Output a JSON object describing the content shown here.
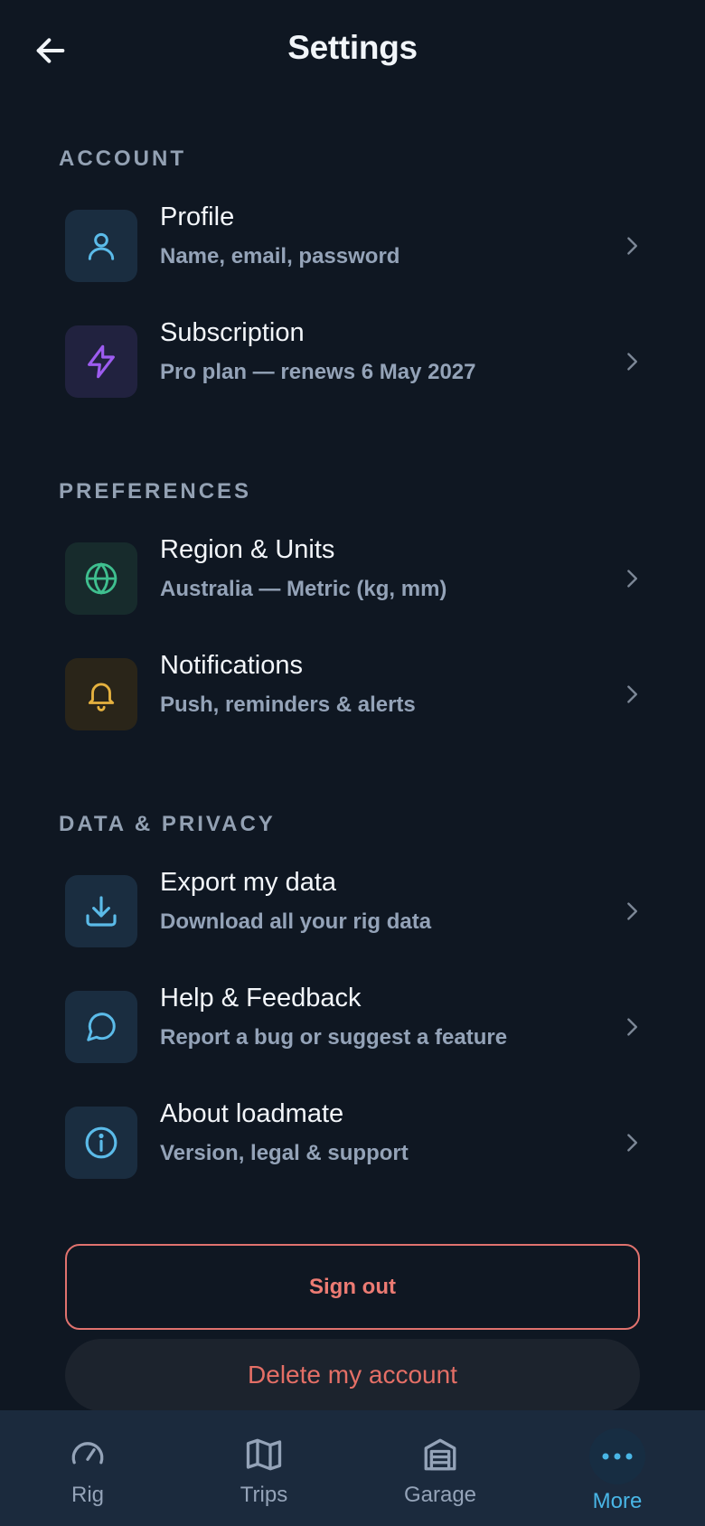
{
  "header": {
    "title": "Settings"
  },
  "sections": {
    "account": {
      "title": "ACCOUNT",
      "items": [
        {
          "title": "Profile",
          "subtitle": "Name, email, password",
          "icon": "user-icon"
        },
        {
          "title": "Subscription",
          "subtitle": "Pro plan — renews 6 May 2027",
          "icon": "lightning-icon"
        }
      ]
    },
    "preferences": {
      "title": "PREFERENCES",
      "items": [
        {
          "title": "Region & Units",
          "subtitle": "Australia — Metric (kg, mm)",
          "icon": "globe-icon"
        },
        {
          "title": "Notifications",
          "subtitle": "Push, reminders & alerts",
          "icon": "bell-icon"
        }
      ]
    },
    "privacy": {
      "title": "DATA & PRIVACY",
      "items": [
        {
          "title": "Export my data",
          "subtitle": "Download all your rig data",
          "icon": "download-icon"
        },
        {
          "title": "Help & Feedback",
          "subtitle": "Report a bug or suggest a feature",
          "icon": "chat-bubble-icon"
        },
        {
          "title": "About loadmate",
          "subtitle": "Version, legal & support",
          "icon": "info-icon"
        }
      ]
    }
  },
  "actions": {
    "sign_out": "Sign out",
    "delete_account": "Delete my account"
  },
  "nav": {
    "items": [
      {
        "label": "Rig",
        "icon": "gauge-icon"
      },
      {
        "label": "Trips",
        "icon": "map-icon"
      },
      {
        "label": "Garage",
        "icon": "garage-icon"
      },
      {
        "label": "More",
        "icon": "more-dots-icon",
        "active": true
      }
    ]
  },
  "colors": {
    "background": "#0f1722",
    "accent": "#49b6e6",
    "danger": "#ec7b73",
    "profile_icon": "#5bbbe9",
    "subscription_icon": "#9d5cf0",
    "region_icon": "#3fbf8f",
    "notifications_icon": "#e6b23f"
  }
}
